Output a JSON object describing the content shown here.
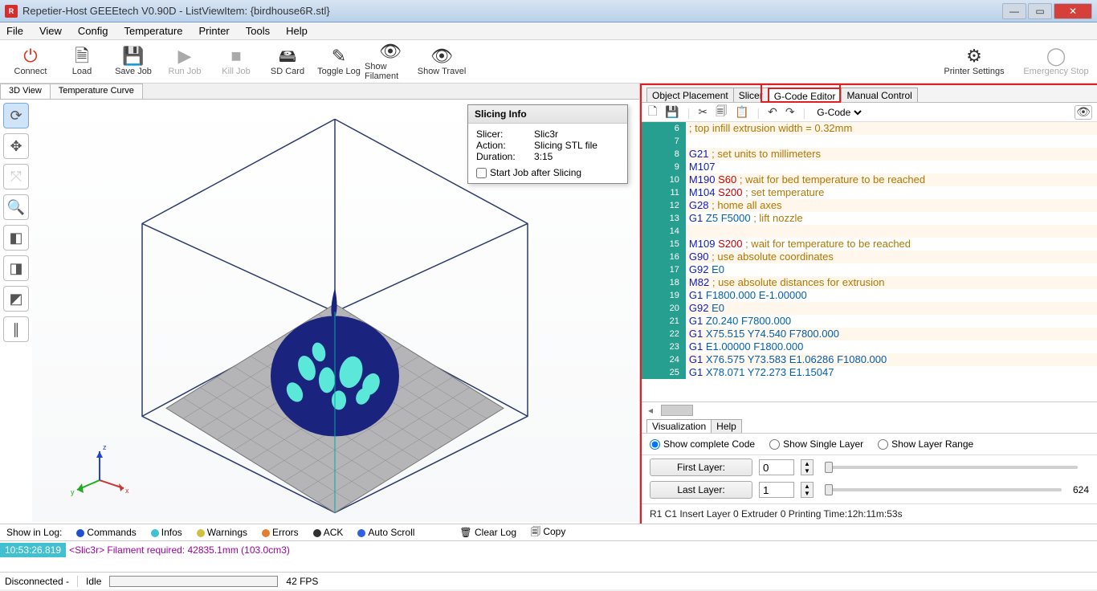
{
  "window": {
    "title": "Repetier-Host GEEEtech V0.90D - ListViewItem: {birdhouse6R.stl}"
  },
  "menu": [
    "File",
    "View",
    "Config",
    "Temperature",
    "Printer",
    "Tools",
    "Help"
  ],
  "toolbar": [
    {
      "label": "Connect",
      "icon": "⏻",
      "color": "#d32"
    },
    {
      "label": "Load",
      "icon": "🗎"
    },
    {
      "label": "Save Job",
      "icon": "💾"
    },
    {
      "label": "Run Job",
      "icon": "▶",
      "disabled": true
    },
    {
      "label": "Kill Job",
      "icon": "■",
      "disabled": true
    },
    {
      "label": "SD Card",
      "icon": "🖴"
    },
    {
      "label": "Toggle Log",
      "icon": "✎"
    },
    {
      "label": "Show Filament",
      "icon": "👁"
    },
    {
      "label": "Show Travel",
      "icon": "👁"
    }
  ],
  "toolbar_right": [
    {
      "label": "Printer Settings",
      "icon": "⚙⚙"
    },
    {
      "label": "Emergency Stop",
      "icon": "◯",
      "disabled": true
    }
  ],
  "left_tabs": [
    "3D View",
    "Temperature Curve"
  ],
  "slicing_info": {
    "title": "Slicing Info",
    "slicer_label": "Slicer:",
    "slicer": "Slic3r",
    "action_label": "Action:",
    "action": "Slicing STL file",
    "duration_label": "Duration:",
    "duration": "3:15",
    "chk_label": "Start Job after Slicing"
  },
  "right_tabs": [
    "Object Placement",
    "Slicer",
    "G-Code Editor",
    "Manual Control"
  ],
  "gcode_dropdown": "G-Code",
  "gcode_lines": [
    {
      "n": 6,
      "text": "; top infill extrusion width = 0.32mm",
      "cls": "comment"
    },
    {
      "n": 7,
      "text": "",
      "cls": "blank"
    },
    {
      "n": 8,
      "text": "G21 ; set units to millimeters",
      "cls": "gc"
    },
    {
      "n": 9,
      "text": "M107",
      "cls": "m"
    },
    {
      "n": 10,
      "text": "M190 S60 ; wait for bed temperature to be reached",
      "cls": "ms"
    },
    {
      "n": 11,
      "text": "M104 S200 ; set temperature",
      "cls": "ms"
    },
    {
      "n": 12,
      "text": "G28 ; home all axes",
      "cls": "gc"
    },
    {
      "n": 13,
      "text": "G1 Z5 F5000 ; lift nozzle",
      "cls": "gv"
    },
    {
      "n": 14,
      "text": "",
      "cls": "blank"
    },
    {
      "n": 15,
      "text": "M109 S200 ; wait for temperature to be reached",
      "cls": "ms"
    },
    {
      "n": 16,
      "text": "G90 ; use absolute coordinates",
      "cls": "gc"
    },
    {
      "n": 17,
      "text": "G92 E0",
      "cls": "gv"
    },
    {
      "n": 18,
      "text": "M82 ; use absolute distances for extrusion",
      "cls": "m"
    },
    {
      "n": 19,
      "text": "G1 F1800.000 E-1.00000",
      "cls": "gv"
    },
    {
      "n": 20,
      "text": "G92 E0",
      "cls": "gv"
    },
    {
      "n": 21,
      "text": "G1 Z0.240 F7800.000",
      "cls": "gv"
    },
    {
      "n": 22,
      "text": "G1 X75.515 Y74.540 F7800.000",
      "cls": "gv"
    },
    {
      "n": 23,
      "text": "G1 E1.00000 F1800.000",
      "cls": "gv"
    },
    {
      "n": 24,
      "text": "G1 X76.575 Y73.583 E1.06286 F1080.000",
      "cls": "gv"
    },
    {
      "n": 25,
      "text": "G1 X78.071 Y72.273 E1.15047",
      "cls": "gv"
    }
  ],
  "subtabs": [
    "Visualization",
    "Help"
  ],
  "viz_opts": {
    "complete": "Show complete Code",
    "single": "Show Single Layer",
    "range": "Show Layer Range"
  },
  "layers": {
    "first_label": "First Layer:",
    "first": "0",
    "last_label": "Last Layer:",
    "last": "1",
    "max": "624"
  },
  "status_line": "R1  C1  Insert  Layer 0  Extruder 0  Printing Time:12h:11m:53s",
  "log_toolbar": {
    "show": "Show in Log:",
    "cmds": "Commands",
    "infos": "Infos",
    "warn": "Warnings",
    "err": "Errors",
    "ack": "ACK",
    "auto": "Auto Scroll",
    "clear": "Clear Log",
    "copy": "Copy"
  },
  "log": {
    "ts": "10:53:26.819",
    "msg": "<Slic3r> Filament required: 42835.1mm (103.0cm3)"
  },
  "statusbar": {
    "conn": "Disconnected  -",
    "idle": "Idle",
    "fps": "42 FPS"
  }
}
